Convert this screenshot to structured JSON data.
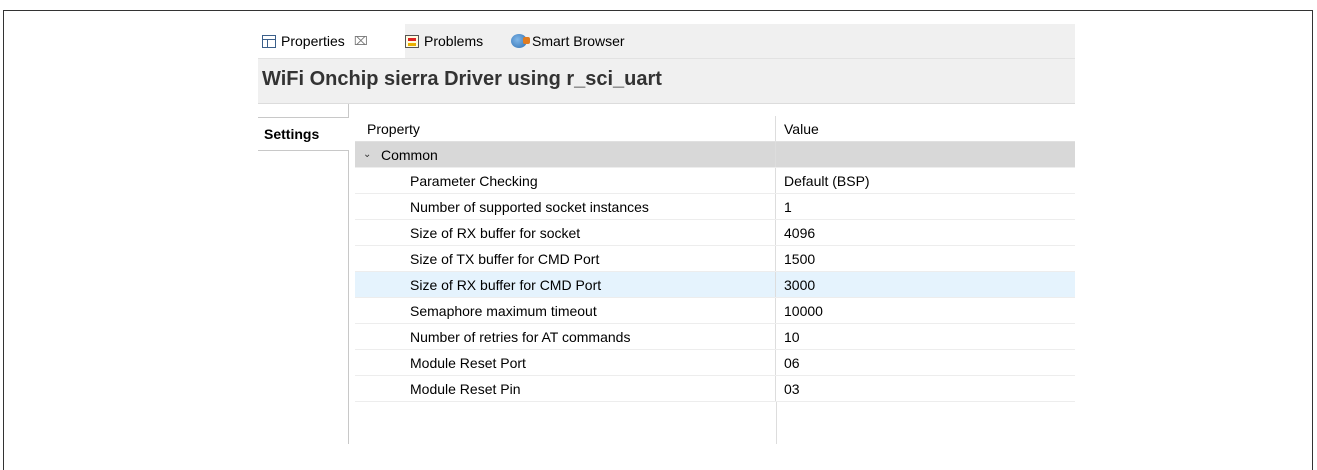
{
  "tabs": [
    {
      "label": "Properties",
      "icon": "properties-icon",
      "close_glyph": "⌧"
    },
    {
      "label": "Problems",
      "icon": "problems-icon"
    },
    {
      "label": "Smart Browser",
      "icon": "smart-browser-icon"
    }
  ],
  "title": "WiFi Onchip sierra Driver using r_sci_uart",
  "side_tabs": [
    {
      "label": "Settings"
    }
  ],
  "table": {
    "header": {
      "property": "Property",
      "value": "Value"
    },
    "group": {
      "label": "Common",
      "chevron": "⌄"
    },
    "rows": [
      {
        "property": "Parameter Checking",
        "value": "Default (BSP)"
      },
      {
        "property": "Number of supported socket instances",
        "value": "1"
      },
      {
        "property": "Size of RX buffer for socket",
        "value": "4096"
      },
      {
        "property": "Size of TX buffer for CMD Port",
        "value": "1500"
      },
      {
        "property": "Size of RX buffer for CMD Port",
        "value": "3000"
      },
      {
        "property": "Semaphore maximum timeout",
        "value": "10000"
      },
      {
        "property": "Number of retries for AT commands",
        "value": "10"
      },
      {
        "property": "Module Reset Port",
        "value": "06"
      },
      {
        "property": "Module Reset Pin",
        "value": "03"
      }
    ]
  },
  "colors": {
    "selected_row": "#e5f3fd",
    "group_row": "#d8d8d8",
    "tab_bar": "#f0f0f0"
  }
}
